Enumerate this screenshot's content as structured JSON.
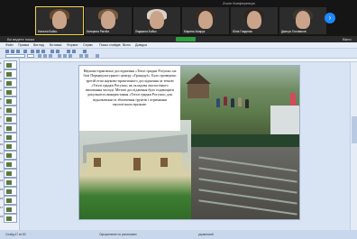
{
  "zoom": {
    "window_title": "Zoom Конференція",
    "participants": [
      {
        "name": "Наталія Бойко",
        "hair": "#6b4a2b"
      },
      {
        "name": "Катерина Рагоба"
      },
      {
        "name": "Людмила Бойко",
        "hair": "#8b6a4a"
      },
      {
        "name": "Марина Хмарук",
        "hair": "#3a2a1e"
      },
      {
        "name": "Юлія Гладенко",
        "hair": "#2e2520"
      },
      {
        "name": "Дмитро Голованов",
        "hair": "#3c3630"
      }
    ]
  },
  "share": {
    "label": "Ви ведете показ",
    "right_label": "Вікно"
  },
  "ppt": {
    "menus": [
      "Файл",
      "Правка",
      "Вигляд",
      "Вставка",
      "Формат",
      "Сервіс",
      "Показ слайдів",
      "Вікно",
      "Довідка"
    ],
    "slide_numbers": [
      "1",
      "2",
      "3",
      "4",
      "5",
      "6",
      "7",
      "8",
      "9",
      "10",
      "11",
      "12",
      "13",
      "14",
      "15",
      "16",
      "17",
      "18"
    ],
    "status": {
      "slide": "Слайд 47 из 83",
      "design": "Оформление по умолчанию",
      "lang": "украинский"
    }
  },
  "slide": {
    "text": "Науково-практичні дослідження «Теплі грядки Рогуша» на базі Пермакультурного центру «Гранадуї». Було проведено третій етап науково-практичного дослідження за темою «Теплі грядки Рогуша» як складова екологічного виховання молоді. Метою дослідження було подвищити доцільність використання «Теплі грядки Рогуша» для відновлення та збагачення ґрунтів і отримання екологічного врожаю."
  },
  "colors": {
    "zoom_bg": "#151515",
    "share_green": "#2e9f3e",
    "zoom_blue": "#1e88ff",
    "ppt_bg": "#d8e3f3"
  }
}
